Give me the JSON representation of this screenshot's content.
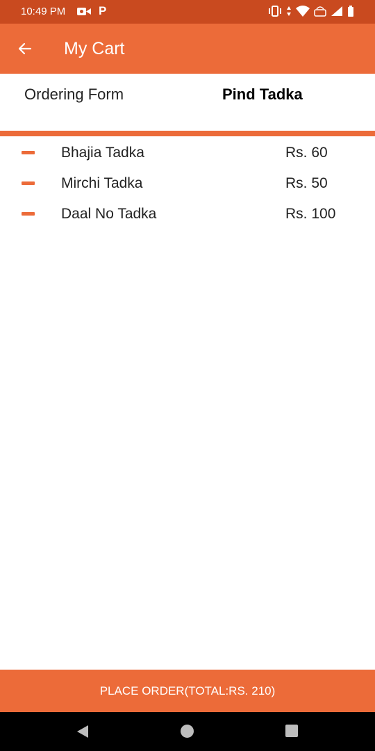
{
  "status_bar": {
    "time": "10:49 PM",
    "icons": [
      "video-call-icon",
      "p-icon",
      "vibrate-icon",
      "data-arrows-icon",
      "wifi-icon",
      "volte-icon",
      "signal-icon",
      "battery-icon"
    ]
  },
  "app_bar": {
    "title": "My Cart",
    "back_icon": "arrow-left-icon"
  },
  "form": {
    "label": "Ordering Form",
    "restaurant": "Pind Tadka"
  },
  "cart": {
    "items": [
      {
        "name": "Bhajia Tadka",
        "price": "Rs. 60"
      },
      {
        "name": "Mirchi Tadka",
        "price": "Rs. 50"
      },
      {
        "name": "Daal No Tadka",
        "price": "Rs. 100"
      }
    ]
  },
  "footer": {
    "place_order_label": "PLACE ORDER(TOTAL:RS. 210)"
  },
  "colors": {
    "accent": "#ec6b39",
    "status_bar": "#c94a1f"
  }
}
